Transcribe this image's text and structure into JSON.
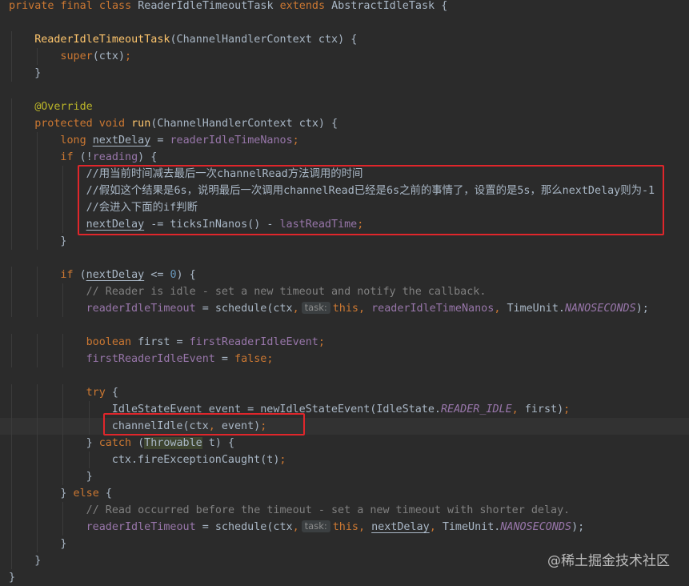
{
  "lines": [
    {
      "indent": 0,
      "tokens": [
        {
          "t": "private final class ",
          "c": "kw"
        },
        {
          "t": "ReaderIdleTimeoutTask ",
          "c": "cls"
        },
        {
          "t": "extends ",
          "c": "kw"
        },
        {
          "t": "AbstractIdleTask ",
          "c": "cls"
        },
        {
          "t": "{",
          "c": "punct"
        }
      ]
    },
    {
      "indent": 0,
      "tokens": []
    },
    {
      "indent": 1,
      "tokens": [
        {
          "t": "ReaderIdleTimeoutTask",
          "c": "fn"
        },
        {
          "t": "(ChannelHandlerContext ctx) {",
          "c": "plain"
        }
      ]
    },
    {
      "indent": 2,
      "tokens": [
        {
          "t": "super",
          "c": "kw"
        },
        {
          "t": "(ctx)",
          "c": "plain"
        },
        {
          "t": ";",
          "c": "kw"
        }
      ]
    },
    {
      "indent": 1,
      "tokens": [
        {
          "t": "}",
          "c": "plain"
        }
      ]
    },
    {
      "indent": 0,
      "tokens": []
    },
    {
      "indent": 1,
      "tokens": [
        {
          "t": "@Override",
          "c": "ann"
        }
      ]
    },
    {
      "indent": 1,
      "tokens": [
        {
          "t": "protected void ",
          "c": "kw"
        },
        {
          "t": "run",
          "c": "fn"
        },
        {
          "t": "(ChannelHandlerContext ctx) {",
          "c": "plain"
        }
      ]
    },
    {
      "indent": 2,
      "tokens": [
        {
          "t": "long ",
          "c": "kw"
        },
        {
          "t": "nextDelay",
          "c": "plain ul"
        },
        {
          "t": " = ",
          "c": "plain"
        },
        {
          "t": "readerIdleTimeNanos",
          "c": "field"
        },
        {
          "t": ";",
          "c": "kw"
        }
      ]
    },
    {
      "indent": 2,
      "tokens": [
        {
          "t": "if ",
          "c": "kw"
        },
        {
          "t": "(!",
          "c": "plain"
        },
        {
          "t": "reading",
          "c": "field"
        },
        {
          "t": ") {",
          "c": "plain"
        }
      ]
    },
    {
      "indent": 3,
      "tokens": [
        {
          "t": "//用当前时间减去最后一次channelRead方法调用的时间",
          "c": "cmt-zh"
        }
      ]
    },
    {
      "indent": 3,
      "tokens": [
        {
          "t": "//假如这个结果是6s，说明最后一次调用channelRead已经是6s之前的事情了，设置的是5s，那么nextDelay则为-1",
          "c": "cmt-zh"
        }
      ]
    },
    {
      "indent": 3,
      "tokens": [
        {
          "t": "//会进入下面的if判断",
          "c": "cmt-zh"
        }
      ]
    },
    {
      "indent": 3,
      "tokens": [
        {
          "t": "nextDelay",
          "c": "plain ul"
        },
        {
          "t": " -= ",
          "c": "plain"
        },
        {
          "t": "ticksInNanos",
          "c": "plain"
        },
        {
          "t": "() - ",
          "c": "plain"
        },
        {
          "t": "lastReadTime",
          "c": "field"
        },
        {
          "t": ";",
          "c": "kw"
        }
      ]
    },
    {
      "indent": 2,
      "tokens": [
        {
          "t": "}",
          "c": "plain"
        }
      ]
    },
    {
      "indent": 0,
      "tokens": []
    },
    {
      "indent": 2,
      "tokens": [
        {
          "t": "if ",
          "c": "kw"
        },
        {
          "t": "(",
          "c": "plain"
        },
        {
          "t": "nextDelay",
          "c": "plain ul"
        },
        {
          "t": " <= ",
          "c": "plain"
        },
        {
          "t": "0",
          "c": "num"
        },
        {
          "t": ") {",
          "c": "plain"
        }
      ]
    },
    {
      "indent": 3,
      "tokens": [
        {
          "t": "// Reader is idle - set a new timeout and notify the callback.",
          "c": "cmt"
        }
      ]
    },
    {
      "indent": 3,
      "tokens": [
        {
          "t": "readerIdleTimeout",
          "c": "field"
        },
        {
          "t": " = ",
          "c": "plain"
        },
        {
          "t": "schedule",
          "c": "plain"
        },
        {
          "t": "(ctx",
          "c": "plain"
        },
        {
          "t": ",",
          "c": "kw"
        },
        {
          "t": "task:",
          "c": "hint"
        },
        {
          "t": "this",
          "c": "kw"
        },
        {
          "t": ", ",
          "c": "kw"
        },
        {
          "t": "readerIdleTimeNanos",
          "c": "field"
        },
        {
          "t": ", ",
          "c": "kw"
        },
        {
          "t": "TimeUnit.",
          "c": "plain"
        },
        {
          "t": "NANOSECONDS",
          "c": "static"
        },
        {
          "t": ");",
          "c": "plain"
        }
      ]
    },
    {
      "indent": 0,
      "tokens": []
    },
    {
      "indent": 3,
      "tokens": [
        {
          "t": "boolean ",
          "c": "kw"
        },
        {
          "t": "first = ",
          "c": "plain"
        },
        {
          "t": "firstReaderIdleEvent",
          "c": "field"
        },
        {
          "t": ";",
          "c": "kw"
        }
      ]
    },
    {
      "indent": 3,
      "tokens": [
        {
          "t": "firstReaderIdleEvent",
          "c": "field"
        },
        {
          "t": " = ",
          "c": "plain"
        },
        {
          "t": "false",
          "c": "kw"
        },
        {
          "t": ";",
          "c": "kw"
        }
      ]
    },
    {
      "indent": 0,
      "tokens": []
    },
    {
      "indent": 3,
      "tokens": [
        {
          "t": "try ",
          "c": "kw"
        },
        {
          "t": "{",
          "c": "plain"
        }
      ]
    },
    {
      "indent": 4,
      "tokens": [
        {
          "t": "IdleStateEvent event = ",
          "c": "plain"
        },
        {
          "t": "newIdleStateEvent",
          "c": "plain"
        },
        {
          "t": "(IdleState.",
          "c": "plain"
        },
        {
          "t": "READER_IDLE",
          "c": "static"
        },
        {
          "t": ", ",
          "c": "kw"
        },
        {
          "t": "first)",
          "c": "plain"
        },
        {
          "t": ";",
          "c": "kw"
        }
      ]
    },
    {
      "indent": 4,
      "current": true,
      "tokens": [
        {
          "t": "channelIdle",
          "c": "plain"
        },
        {
          "t": "(ctx",
          "c": "plain"
        },
        {
          "t": ", ",
          "c": "kw"
        },
        {
          "t": "event)",
          "c": "plain"
        },
        {
          "t": ";",
          "c": "kw"
        }
      ]
    },
    {
      "indent": 3,
      "tokens": [
        {
          "t": "} ",
          "c": "plain"
        },
        {
          "t": "catch ",
          "c": "kw"
        },
        {
          "t": "(",
          "c": "plain"
        },
        {
          "t": "Throwable",
          "c": "plain hl"
        },
        {
          "t": " t) {",
          "c": "plain"
        }
      ]
    },
    {
      "indent": 4,
      "tokens": [
        {
          "t": "ctx.fireExceptionCaught(t)",
          "c": "plain"
        },
        {
          "t": ";",
          "c": "kw"
        }
      ]
    },
    {
      "indent": 3,
      "tokens": [
        {
          "t": "}",
          "c": "plain"
        }
      ]
    },
    {
      "indent": 2,
      "tokens": [
        {
          "t": "} ",
          "c": "plain"
        },
        {
          "t": "else ",
          "c": "kw"
        },
        {
          "t": "{",
          "c": "plain"
        }
      ]
    },
    {
      "indent": 3,
      "tokens": [
        {
          "t": "// Read occurred before the timeout - set a new timeout with shorter delay.",
          "c": "cmt"
        }
      ]
    },
    {
      "indent": 3,
      "tokens": [
        {
          "t": "readerIdleTimeout",
          "c": "field"
        },
        {
          "t": " = ",
          "c": "plain"
        },
        {
          "t": "schedule",
          "c": "plain"
        },
        {
          "t": "(ctx",
          "c": "plain"
        },
        {
          "t": ",",
          "c": "kw"
        },
        {
          "t": "task:",
          "c": "hint"
        },
        {
          "t": "this",
          "c": "kw"
        },
        {
          "t": ", ",
          "c": "kw"
        },
        {
          "t": "nextDelay",
          "c": "plain ul"
        },
        {
          "t": ", ",
          "c": "kw"
        },
        {
          "t": "TimeUnit.",
          "c": "plain"
        },
        {
          "t": "NANOSECONDS",
          "c": "static"
        },
        {
          "t": ");",
          "c": "plain"
        }
      ]
    },
    {
      "indent": 2,
      "tokens": [
        {
          "t": "}",
          "c": "plain"
        }
      ]
    },
    {
      "indent": 1,
      "tokens": [
        {
          "t": "}",
          "c": "plain"
        }
      ]
    },
    {
      "indent": 0,
      "tokens": [
        {
          "t": "}",
          "c": "plain"
        }
      ]
    }
  ],
  "watermark": "@稀土掘金技术社区",
  "colors": {
    "background": "#2b2b2b",
    "keyword": "#cc7832",
    "method": "#ffc66d",
    "field": "#9876aa",
    "comment": "#808080",
    "number": "#6897bb",
    "annotation": "#bbb529",
    "highlight_box": "#e0262b"
  }
}
